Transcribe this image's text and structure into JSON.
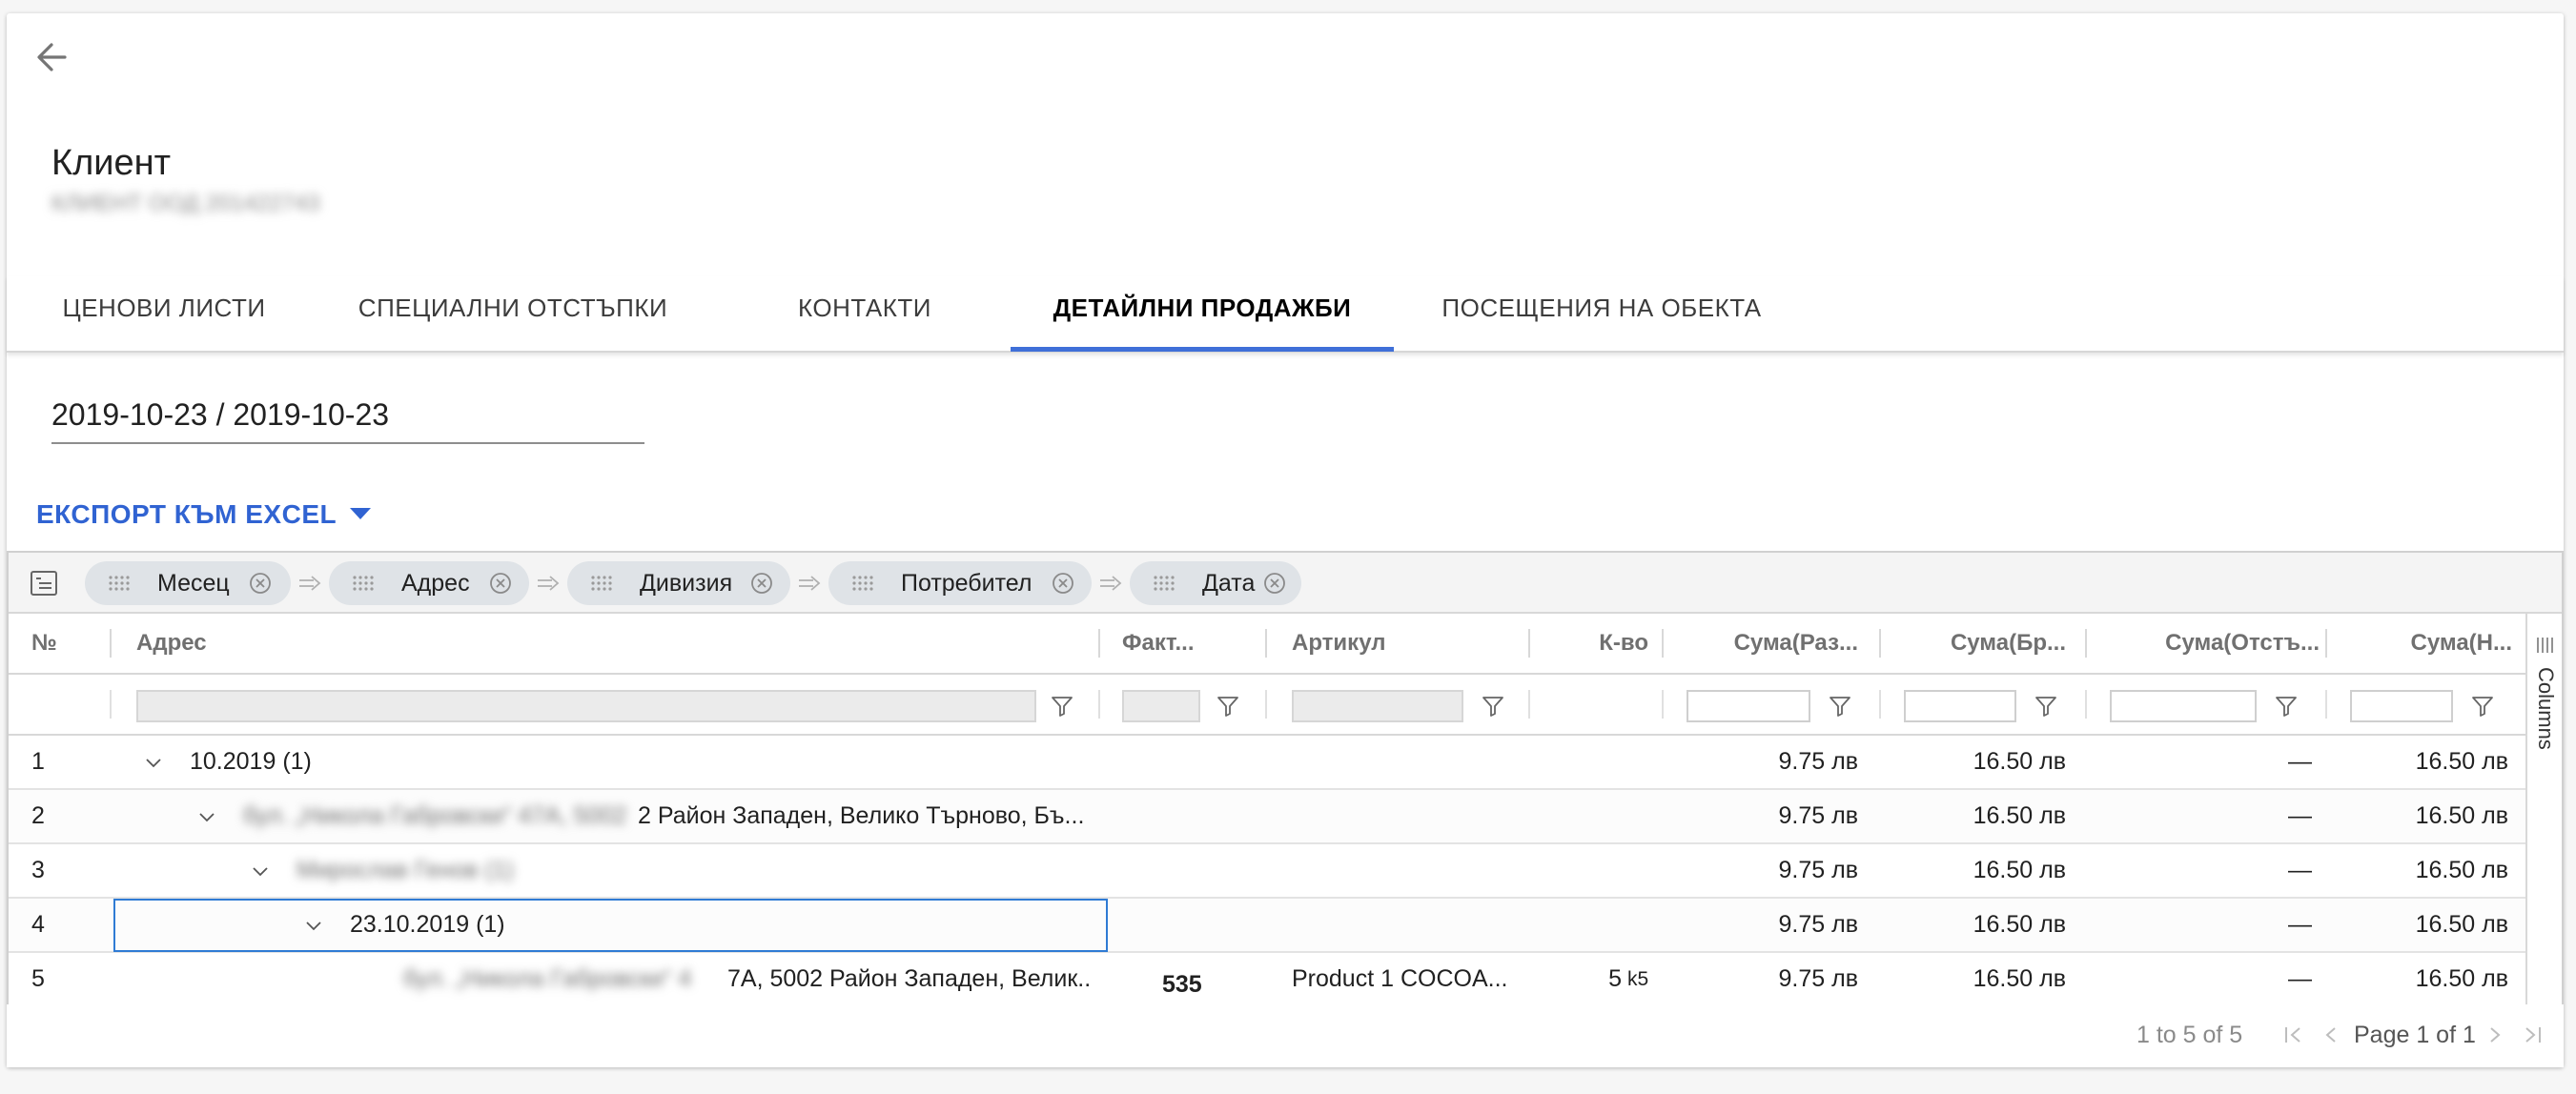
{
  "header": {
    "back_icon": "arrow-left-icon",
    "title": "Клиент",
    "subtitle": "КЛИЕНТ ООД 201422743"
  },
  "tabs": [
    {
      "label": "ЦЕНОВИ ЛИСТИ",
      "active": false
    },
    {
      "label": "СПЕЦИАЛНИ ОТСТЪПКИ",
      "active": false
    },
    {
      "label": "КОНТАКТИ",
      "active": false
    },
    {
      "label": "ДЕТАЙЛНИ ПРОДАЖБИ",
      "active": true
    },
    {
      "label": "ПОСЕЩЕНИЯ НА ОБЕКТА",
      "active": false
    }
  ],
  "date_range": {
    "value": "2019-10-23 / 2019-10-23"
  },
  "export": {
    "label": "ЕКСПОРТ КЪМ EXCEL"
  },
  "group_bar": {
    "chips": [
      "Месец",
      "Адрес",
      "Дивизия",
      "Потребител",
      "Дата"
    ]
  },
  "grid": {
    "columns": [
      "№",
      "Адрес",
      "Факт...",
      "Артикул",
      "К-во",
      "Сума(Раз...",
      "Сума(Бр...",
      "Сума(Отстъ...",
      "Сума(Н..."
    ],
    "rows": [
      {
        "num": "1",
        "address": "10.2019 (1)",
        "blurred_prefix": "",
        "invoice": "",
        "article": "",
        "qty": "",
        "qty_unit": "",
        "sum1": "9.75 лв",
        "sum2": "16.50 лв",
        "sum3": "—",
        "sum4": "16.50 лв"
      },
      {
        "num": "2",
        "address": "2 Район Западен, Велико Търново, Бъ...",
        "blurred_prefix": "бул. „Никола Габровски“ 47А, 5002",
        "invoice": "",
        "article": "",
        "qty": "",
        "qty_unit": "",
        "sum1": "9.75 лв",
        "sum2": "16.50 лв",
        "sum3": "—",
        "sum4": "16.50 лв"
      },
      {
        "num": "3",
        "address": "",
        "blurred_prefix": "Мирослав Генов (1)",
        "invoice": "",
        "article": "",
        "qty": "",
        "qty_unit": "",
        "sum1": "9.75 лв",
        "sum2": "16.50 лв",
        "sum3": "—",
        "sum4": "16.50 лв"
      },
      {
        "num": "4",
        "address": "23.10.2019 (1)",
        "blurred_prefix": "",
        "invoice": "",
        "article": "",
        "qty": "",
        "qty_unit": "",
        "sum1": "9.75 лв",
        "sum2": "16.50 лв",
        "sum3": "—",
        "sum4": "16.50 лв"
      },
      {
        "num": "5",
        "address": "7А, 5002 Район Западен, Велик...",
        "blurred_prefix": "бул. „Никола Габровски“ 4",
        "invoice": "535",
        "article": "Product 1 COCOA...",
        "qty": "5",
        "qty_unit": "k5",
        "sum1": "9.75 лв",
        "sum2": "16.50 лв",
        "sum3": "—",
        "sum4": "16.50 лв"
      }
    ]
  },
  "side_panel": {
    "label": "Columns"
  },
  "footer": {
    "summary": "1 to 5 of 5",
    "page": "Page 1 of 1"
  }
}
